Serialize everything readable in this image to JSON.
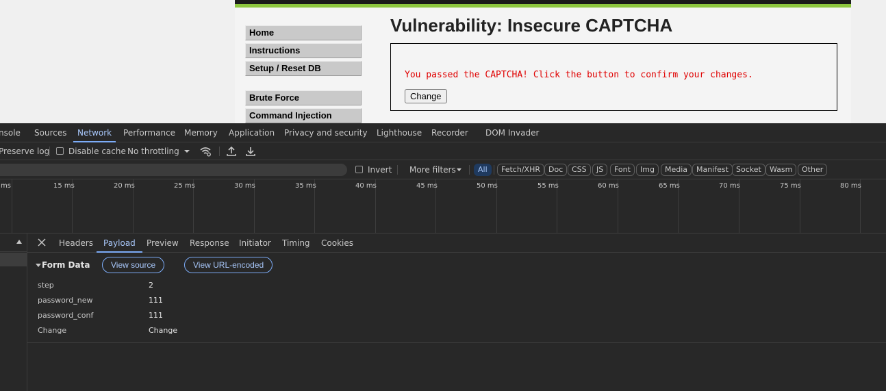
{
  "webpage": {
    "menu": [
      "Home",
      "Instructions",
      "Setup / Reset DB",
      "Brute Force",
      "Command Injection"
    ],
    "title": "Vulnerability: Insecure CAPTCHA",
    "message": "You passed the CAPTCHA! Click the button to confirm your changes.",
    "button": "Change",
    "colors": {
      "accent_green": "#8dc63f",
      "message_red": "#e00000"
    }
  },
  "devtools": {
    "tabs": [
      "nsole",
      "Sources",
      "Network",
      "Performance",
      "Memory",
      "Application",
      "Privacy and security",
      "Lighthouse",
      "Recorder",
      "DOM Invader"
    ],
    "active_tab": "Network",
    "toolbar": {
      "preserve_log": "Preserve log",
      "disable_cache": "Disable cache",
      "throttling": "No throttling",
      "icons": [
        "wifi-settings-icon",
        "upload-icon",
        "download-icon"
      ]
    },
    "filter": {
      "invert": "Invert",
      "more_filters": "More filters",
      "types": [
        "All",
        "Fetch/XHR",
        "Doc",
        "CSS",
        "JS",
        "Font",
        "Img",
        "Media",
        "Manifest",
        "Socket",
        "Wasm",
        "Other"
      ],
      "active_type": "All"
    },
    "timeline_ticks": [
      "ms",
      "15 ms",
      "20 ms",
      "25 ms",
      "30 ms",
      "35 ms",
      "40 ms",
      "45 ms",
      "50 ms",
      "55 ms",
      "60 ms",
      "65 ms",
      "70 ms",
      "75 ms",
      "80 ms"
    ],
    "detail_tabs": [
      "Headers",
      "Payload",
      "Preview",
      "Response",
      "Initiator",
      "Timing",
      "Cookies"
    ],
    "active_detail_tab": "Payload",
    "payload": {
      "section_title": "Form Data",
      "view_source": "View source",
      "view_url_encoded": "View URL-encoded",
      "rows": [
        {
          "key": "step",
          "value": "2"
        },
        {
          "key": "password_new",
          "value": "111"
        },
        {
          "key": "password_conf",
          "value": "111"
        },
        {
          "key": "Change",
          "value": "Change"
        }
      ]
    }
  }
}
